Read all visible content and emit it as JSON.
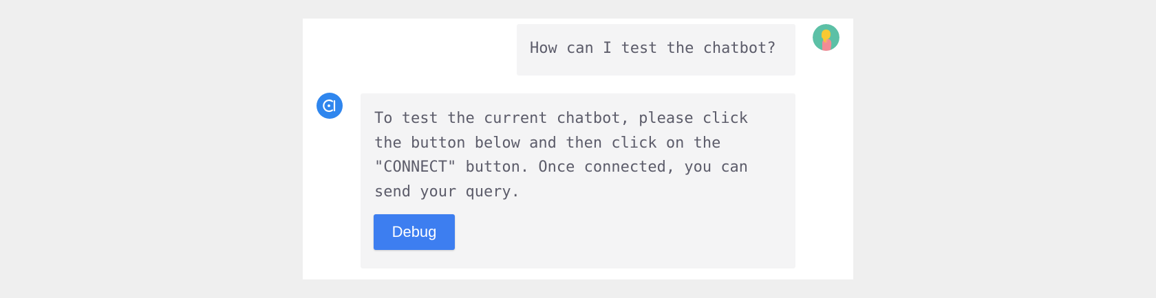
{
  "conversation": {
    "user_message": "How can I test the chatbot?",
    "user_avatar_icon": "user-avatar-icon",
    "bot_avatar_icon": "bot-logo-icon",
    "bot_message": "To test the current chatbot, please click the button below and then click on the \"CONNECT\" button. Once connected, you can send your query.",
    "debug_button_label": "Debug"
  },
  "colors": {
    "page_background": "#efefef",
    "panel_background": "#ffffff",
    "bubble_background": "#f4f4f5",
    "text": "#5c5c6a",
    "bot_avatar": "#2f86ee",
    "button": "#3d7ef0"
  }
}
